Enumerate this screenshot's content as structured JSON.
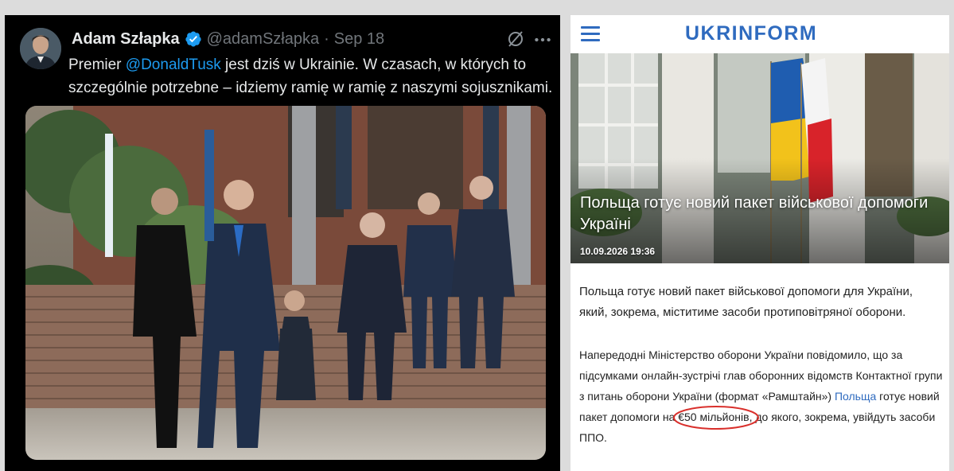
{
  "tweet": {
    "author_name": "Adam Szłapka",
    "handle": "@adamSzłapka",
    "separator": "·",
    "date": "Sep 18",
    "text_before_mention": "Premier ",
    "mention": "@DonaldTusk",
    "text_after_mention": " jest dziś w Ukrainie. W czasach, w których to szczególnie potrzebne – idziemy ramię w ramię z naszymi sojusznikami.",
    "colors": {
      "background": "#000000",
      "link": "#1d9bf0",
      "muted": "#71767b"
    },
    "icons": [
      "verified-badge-icon",
      "grok-icon",
      "more-icon"
    ]
  },
  "ukrinform": {
    "logo": "UKRINFORM",
    "headline": "Польща готує новий пакет військової допомоги Україні",
    "date": "10.09.2026 19:36",
    "lead": "Польща готує новий пакет військової допомоги для України, який, зокрема, міститиме засоби протиповітряної оборони.",
    "body_part1": "Напередодні Міністерство оборони України повідомило, що за підсумками онлайн-зустрічі глав оборонних відомств Контактної групи з питань оборони України (формат «Рамштайн») ",
    "body_link": "Польща",
    "body_part2": " готує новий пакет допомоги на ",
    "body_highlight": "€50 мільйонів",
    "body_part3": ", до якого, зокрема, увійдуть засоби ППО.",
    "colors": {
      "brand": "#2f6bbf",
      "highlight_circle": "#d9302c"
    },
    "icons": [
      "hamburger-menu-icon"
    ]
  }
}
